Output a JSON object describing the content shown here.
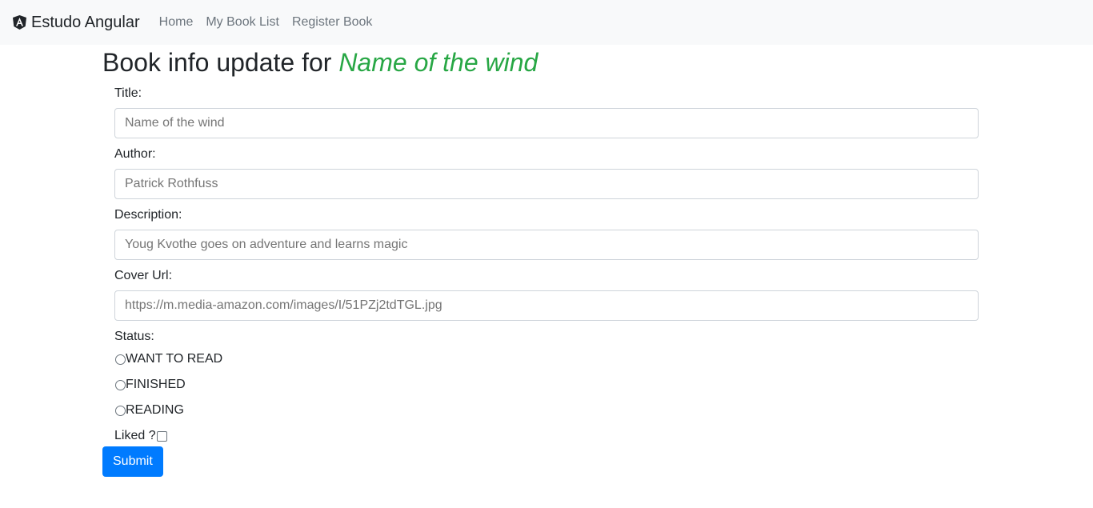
{
  "navbar": {
    "brand": "Estudo Angular",
    "links": [
      "Home",
      "My Book List",
      "Register Book"
    ]
  },
  "page": {
    "title_prefix": "Book info update for ",
    "book_name": "Name of the wind"
  },
  "form": {
    "title_label": "Title:",
    "title_placeholder": "Name of the wind",
    "author_label": "Author:",
    "author_placeholder": "Patrick Rothfuss",
    "description_label": "Description:",
    "description_placeholder": "Youg Kvothe goes on adventure and learns magic",
    "cover_label": "Cover Url:",
    "cover_placeholder": "https://m.media-amazon.com/images/I/51PZj2tdTGL.jpg",
    "status_label": "Status:",
    "status_options": [
      "WANT TO READ",
      "FINISHED",
      "READING"
    ],
    "liked_label": "Liked ?",
    "submit_label": "Submit"
  },
  "colors": {
    "accent": "#28a745",
    "primary": "#007bff",
    "navbar_bg": "#f8f9fa"
  }
}
